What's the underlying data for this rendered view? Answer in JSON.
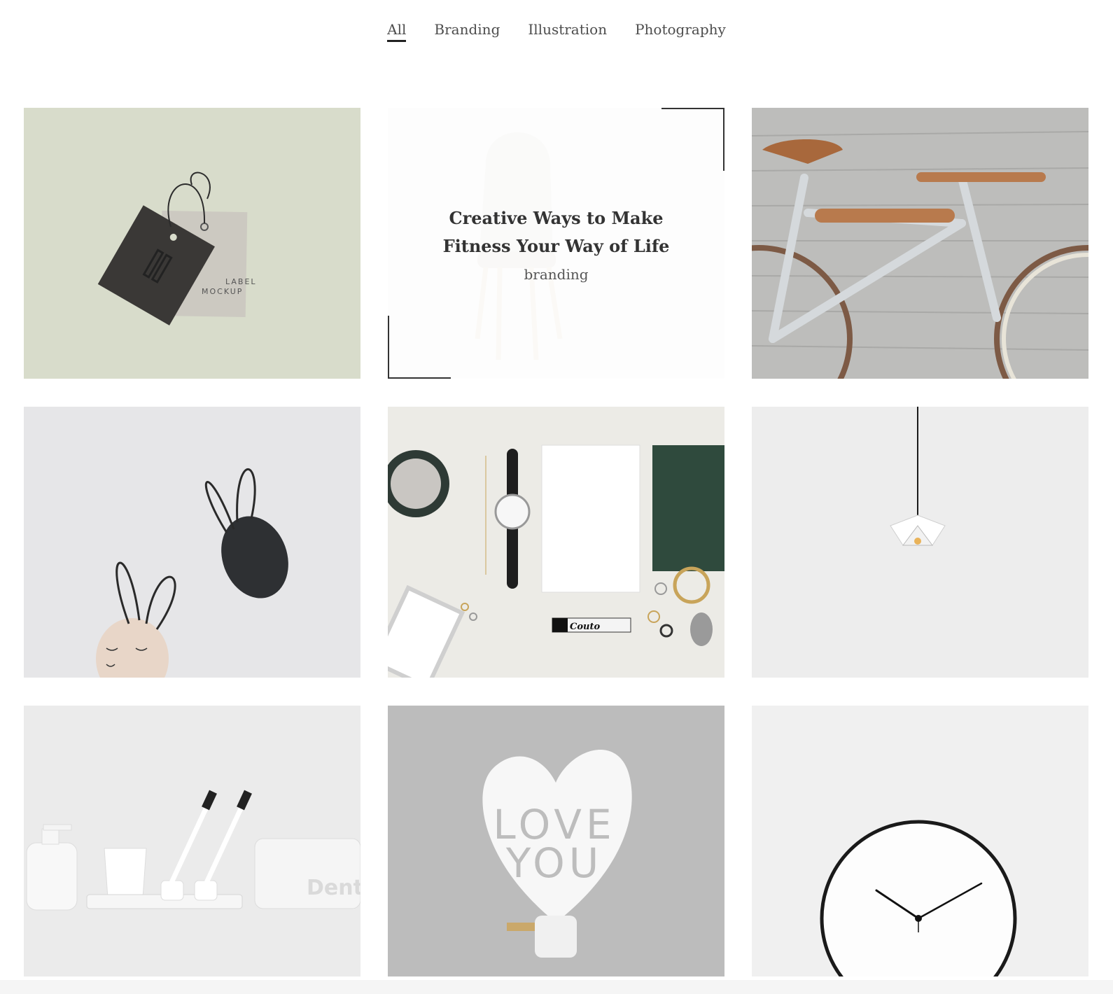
{
  "filters": [
    {
      "label": "All",
      "active": true
    },
    {
      "label": "Branding",
      "active": false
    },
    {
      "label": "Illustration",
      "active": false
    },
    {
      "label": "Photography",
      "active": false
    }
  ],
  "tiles": [
    {
      "image": "label-mockup-photo",
      "label_text": [
        "LABEL",
        "MOCKUP"
      ],
      "bg": "#d8dccb"
    },
    {
      "image": "chair-photo",
      "bg": "#f4f4f2",
      "overlay": {
        "title": "Creative Ways to Make Fitness Your Way of Life",
        "category": "branding"
      }
    },
    {
      "image": "bicycle-photo",
      "bg": "#bdbdbb"
    },
    {
      "image": "easter-eggs-bunny-photo",
      "bg": "#e6e6e8"
    },
    {
      "image": "flatlay-watch-notebook-photo",
      "bg": "#ecebe6",
      "tube_text": "Couto"
    },
    {
      "image": "pendant-lamp-photo",
      "bg": "#ededed"
    },
    {
      "image": "bathroom-toothbrush-photo",
      "bg": "#ebebeb",
      "box_text": "Denti"
    },
    {
      "image": "love-you-heart-photo",
      "bg": "#bcbcbc",
      "heart_text": [
        "LOVE",
        "YOU"
      ]
    },
    {
      "image": "wall-clock-photo",
      "bg": "#f0f0f0"
    }
  ]
}
